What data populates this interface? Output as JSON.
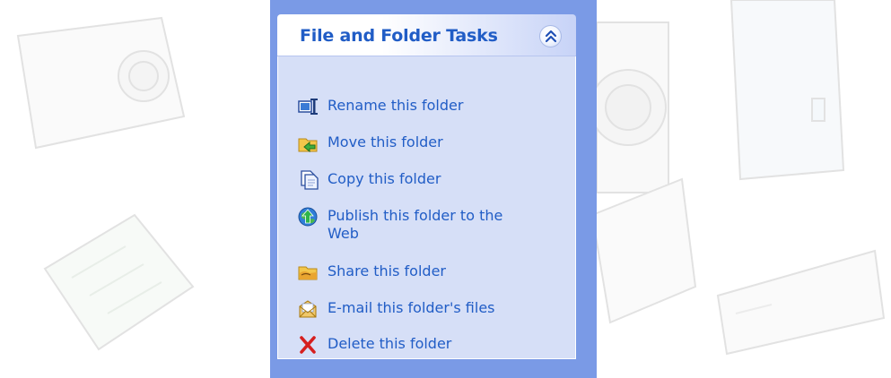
{
  "panel": {
    "title": "File and Folder Tasks",
    "collapse_icon": "double-chevron-up-icon",
    "colors": {
      "title": "#215dc6",
      "link": "#215dc6",
      "body_bg": "#d6dff7",
      "pane_bg": "#7a9ae6"
    },
    "tasks": [
      {
        "label": "Rename this folder",
        "icon": "rename-icon"
      },
      {
        "label": "Move this folder",
        "icon": "move-folder-icon"
      },
      {
        "label": "Copy this folder",
        "icon": "copy-icon"
      },
      {
        "label": "Publish this folder to the Web",
        "icon": "publish-web-icon"
      },
      {
        "label": "Share this folder",
        "icon": "share-folder-icon"
      },
      {
        "label": "E-mail this folder's files",
        "icon": "email-icon"
      },
      {
        "label": "Delete this folder",
        "icon": "delete-icon"
      }
    ]
  }
}
